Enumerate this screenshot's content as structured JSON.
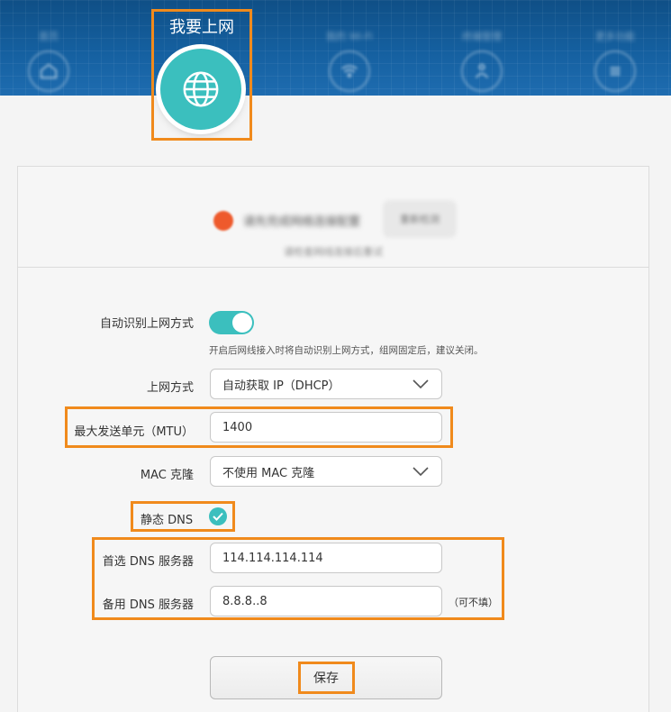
{
  "nav": {
    "items": [
      {
        "label": "首页",
        "icon": "home-icon"
      },
      {
        "label": "我要上网",
        "icon": "globe-icon",
        "active": true
      },
      {
        "label": "我的 Wi-Fi",
        "icon": "wifi-icon"
      },
      {
        "label": "终端管理",
        "icon": "devices-icon"
      },
      {
        "label": "更多功能",
        "icon": "menu-icon"
      }
    ]
  },
  "status": {
    "text": "请先完成网络连接配置",
    "button": "重新检测",
    "subtext": "请检查网线连接后重试"
  },
  "form": {
    "auto_detect_label": "自动识别上网方式",
    "auto_detect_on": true,
    "auto_detect_hint": "开启后网线接入时将自动识别上网方式，组网固定后，建议关闭。",
    "wan_mode_label": "上网方式",
    "wan_mode_value": "自动获取 IP（DHCP）",
    "mtu_label": "最大发送单元（MTU）",
    "mtu_value": "1400",
    "mac_clone_label": "MAC 克隆",
    "mac_clone_value": "不使用 MAC 克隆",
    "static_dns_label": "静态 DNS",
    "static_dns_checked": true,
    "primary_dns_label": "首选 DNS 服务器",
    "primary_dns_value": "114.114.114.114",
    "secondary_dns_label": "备用 DNS 服务器",
    "secondary_dns_value": "8.8.8..8",
    "secondary_dns_optional": "（可不填）",
    "save_label": "保存"
  },
  "colors": {
    "accent": "#3bbfbe",
    "highlight": "#f08a1c",
    "header": "#1560a0",
    "status_error": "#ee5a2c"
  }
}
